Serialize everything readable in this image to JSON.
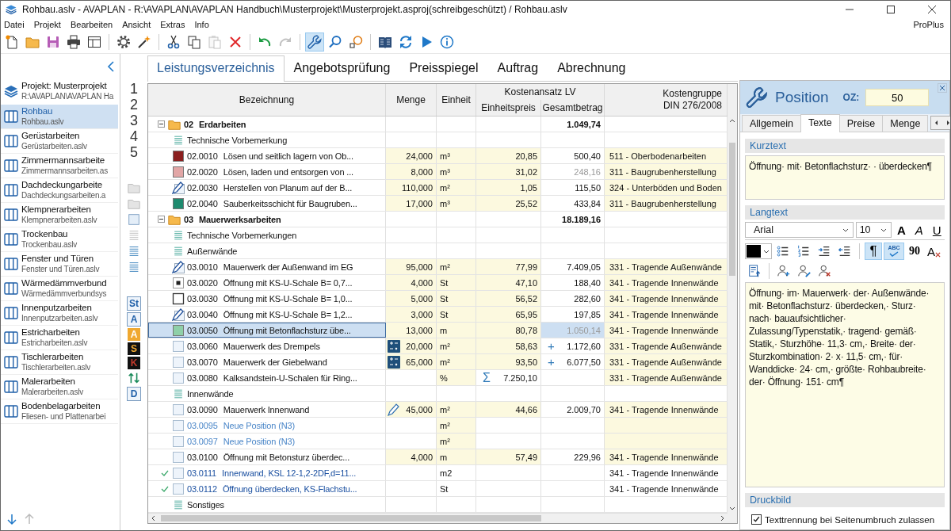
{
  "window": {
    "title": "Rohbau.aslv - AVAPLAN - R:\\AVAPLAN\\AVAPLAN Handbuch\\Musterprojekt\\Musterprojekt.asproj(schreibgeschützt) / Rohbau.aslv"
  },
  "menu": [
    "Datei",
    "Projekt",
    "Bearbeiten",
    "Ansicht",
    "Extras",
    "Info"
  ],
  "edition": "ProPlus",
  "toolbar": [
    {
      "kind": "new",
      "disabled": false,
      "pressed": false
    },
    {
      "kind": "open",
      "disabled": false,
      "pressed": false
    },
    {
      "kind": "save",
      "disabled": false,
      "pressed": false
    },
    {
      "kind": "print",
      "disabled": false,
      "pressed": false
    },
    {
      "kind": "layout",
      "disabled": false,
      "pressed": false
    },
    {
      "kind": "separator"
    },
    {
      "kind": "settings",
      "disabled": false,
      "pressed": false
    },
    {
      "kind": "wand",
      "disabled": false,
      "pressed": false
    },
    {
      "kind": "separator"
    },
    {
      "kind": "cut",
      "disabled": false,
      "pressed": false
    },
    {
      "kind": "copy",
      "disabled": false,
      "pressed": false
    },
    {
      "kind": "paste",
      "disabled": true,
      "pressed": false
    },
    {
      "kind": "delete",
      "disabled": false,
      "pressed": false
    },
    {
      "kind": "separator"
    },
    {
      "kind": "undo",
      "disabled": false,
      "pressed": false
    },
    {
      "kind": "redo",
      "disabled": true,
      "pressed": false
    },
    {
      "kind": "separator"
    },
    {
      "kind": "wrench",
      "disabled": false,
      "pressed": true
    },
    {
      "kind": "search",
      "disabled": false,
      "pressed": false
    },
    {
      "kind": "sum",
      "disabled": false,
      "pressed": false
    },
    {
      "kind": "separator"
    },
    {
      "kind": "book",
      "disabled": false,
      "pressed": false
    },
    {
      "kind": "refresh",
      "disabled": false,
      "pressed": false
    },
    {
      "kind": "play",
      "disabled": false,
      "pressed": false
    },
    {
      "kind": "info",
      "disabled": false,
      "pressed": false
    }
  ],
  "sidebar": {
    "project": {
      "name": "Projekt: Musterprojekt",
      "path": "R:\\AVAPLAN\\AVAPLAN Ha"
    },
    "items": [
      {
        "name": "Rohbau",
        "file": "Rohbau.aslv",
        "selected": true
      },
      {
        "name": "Gerüstarbeiten",
        "file": "Gerüstarbeiten.aslv",
        "selected": false
      },
      {
        "name": "Zimmermannsarbeite",
        "file": "Zimmermannsarbeiten.as",
        "selected": false
      },
      {
        "name": "Dachdeckungarbeite",
        "file": "Dachdeckungsarbeiten.a",
        "selected": false
      },
      {
        "name": "Klempnerarbeiten",
        "file": "Klempnerarbeiten.aslv",
        "selected": false
      },
      {
        "name": "Trockenbau",
        "file": "Trockenbau.aslv",
        "selected": false
      },
      {
        "name": "Fenster und Türen",
        "file": "Fenster und Türen.aslv",
        "selected": false
      },
      {
        "name": "Wärmedämmverbund",
        "file": "Wärmedämmverbundsys",
        "selected": false
      },
      {
        "name": "Innenputzarbeiten",
        "file": "Innenputzarbeiten.aslv",
        "selected": false
      },
      {
        "name": "Estricharbeiten",
        "file": "Estricharbeiten.aslv",
        "selected": false
      },
      {
        "name": "Tischlerarbeiten",
        "file": "Tischlerarbeiten.aslv",
        "selected": false
      },
      {
        "name": "Malerarbeiten",
        "file": "Malerarbeiten.aslv",
        "selected": false
      },
      {
        "name": "Bodenbelagarbeiten",
        "file": "Fliesen- und Plattenarbei",
        "selected": false
      }
    ]
  },
  "levels": [
    "1",
    "2",
    "3",
    "4",
    "5"
  ],
  "filters": [
    {
      "kind": "folder"
    },
    {
      "kind": "folder"
    },
    {
      "kind": "box"
    },
    {
      "kind": "lines-muted"
    },
    {
      "kind": "lines"
    },
    {
      "kind": "lines"
    },
    {
      "kind": "badge-light",
      "label": "St"
    },
    {
      "kind": "badge-light",
      "label": "A"
    },
    {
      "kind": "badge-orange",
      "label": "A"
    },
    {
      "kind": "badge-black-orange",
      "label": "S"
    },
    {
      "kind": "badge-black-red",
      "label": "K"
    },
    {
      "kind": "swap"
    },
    {
      "kind": "badge-light",
      "label": "D"
    }
  ],
  "tabs": [
    {
      "label": "Leistungsverzeichnis",
      "selected": true
    },
    {
      "label": "Angebotsprüfung",
      "selected": false
    },
    {
      "label": "Preisspiegel",
      "selected": false
    },
    {
      "label": "Auftrag",
      "selected": false
    },
    {
      "label": "Abrechnung",
      "selected": false
    }
  ],
  "table": {
    "columns": {
      "name": "Bezeichnung",
      "menge": "Menge",
      "einheit": "Einheit",
      "cost": "Kostenansatz LV",
      "ep": "Einheitspreis",
      "gb": "Gesamtbetrag",
      "kg": "Kostengruppe\nDIN 276/2008"
    },
    "rows": [
      {
        "kind": "group",
        "oz": "02",
        "text": "Erdarbeiten",
        "gb": "1.049,74",
        "expanded": true,
        "selected": false
      },
      {
        "kind": "note",
        "text": "Technische Vorbemerkung",
        "selected": false
      },
      {
        "kind": "item",
        "oz": "02.0010",
        "text": "Lösen und seitlich lagern von Ob...",
        "menge": "24,000",
        "einheit": "m³",
        "ep": "20,85",
        "gb": "500,40",
        "kg": "511 - Oberbodenarbeiten",
        "marker": {
          "kind": "swatch",
          "color": "#8b1f1f"
        },
        "selected": false,
        "shaded": true,
        "ticked": false
      },
      {
        "kind": "item",
        "oz": "02.0020",
        "text": "Lösen, laden und entsorgen von ...",
        "menge": "8,000",
        "einheit": "m³",
        "ep": "31,02",
        "gb": "248,16",
        "gb_muted": true,
        "kg": "311 - Baugrubenherstellung",
        "marker": {
          "kind": "swatch",
          "color": "#e2a6a6"
        },
        "selected": false,
        "shaded": true,
        "ticked": false
      },
      {
        "kind": "item",
        "oz": "02.0030",
        "text": "Herstellen von Planum auf der B...",
        "menge": "110,000",
        "einheit": "m²",
        "ep": "1,05",
        "gb": "115,50",
        "kg": "324 - Unterböden und Boden",
        "marker": {
          "kind": "pen"
        },
        "selected": false,
        "shaded": true,
        "ticked": false
      },
      {
        "kind": "item",
        "oz": "02.0040",
        "text": "Sauberkeitsschicht für Baugruben...",
        "menge": "17,000",
        "einheit": "m³",
        "ep": "25,52",
        "gb": "433,84",
        "kg": "311 - Baugrubenherstellung",
        "marker": {
          "kind": "swatch",
          "color": "#1e8a6e"
        },
        "selected": false,
        "shaded": true,
        "ticked": false
      },
      {
        "kind": "group",
        "oz": "03",
        "text": "Mauerwerksarbeiten",
        "gb": "18.189,16",
        "expanded": true,
        "selected": false
      },
      {
        "kind": "note",
        "text": "Technische Vorbemerkungen",
        "selected": false
      },
      {
        "kind": "note",
        "text": "Außenwände",
        "selected": false
      },
      {
        "kind": "item",
        "oz": "03.0010",
        "text": "Mauerwerk der Außenwand im EG",
        "menge": "95,000",
        "einheit": "m²",
        "ep": "77,99",
        "gb": "7.409,05",
        "kg": "331 - Tragende Außenwände",
        "marker": {
          "kind": "pen"
        },
        "selected": false,
        "shaded": true,
        "ticked": false
      },
      {
        "kind": "item",
        "oz": "03.0020",
        "text": "Öffnung mit KS-U-Schale B= 0,7...",
        "menge": "4,000",
        "einheit": "St",
        "ep": "47,10",
        "gb": "188,40",
        "kg": "341 - Tragende Innenwände",
        "marker": {
          "kind": "dot"
        },
        "selected": false,
        "shaded": true,
        "ticked": false
      },
      {
        "kind": "item",
        "oz": "03.0030",
        "text": "Öffnung mit KS-U-Schale B= 1,0...",
        "menge": "5,000",
        "einheit": "St",
        "ep": "56,52",
        "gb": "282,60",
        "kg": "341 - Tragende Innenwände",
        "marker": {
          "kind": "box"
        },
        "selected": false,
        "shaded": true,
        "ticked": false
      },
      {
        "kind": "item",
        "oz": "03.0040",
        "text": "Öffnung mit KS-U-Schale B= 1,2...",
        "menge": "3,000",
        "einheit": "St",
        "ep": "65,95",
        "gb": "197,85",
        "kg": "341 - Tragende Innenwände",
        "marker": {
          "kind": "pen"
        },
        "selected": false,
        "shaded": true,
        "ticked": false
      },
      {
        "kind": "item",
        "oz": "03.0050",
        "text": "Öffnung mit Betonflachsturz  übe...",
        "menge": "13,000",
        "einheit": "m",
        "ep": "80,78",
        "gb": "1.050,14",
        "gb_muted": true,
        "kg": "341 - Tragende Innenwände",
        "marker": {
          "kind": "swatch",
          "color": "#8fd0a8"
        },
        "selected": true,
        "shaded": true,
        "ticked": false
      },
      {
        "kind": "item",
        "oz": "03.0060",
        "text": "Mauerwerk des Drempels",
        "menge_tool": {
          "kind": "calc"
        },
        "menge": "20,000",
        "einheit": "m²",
        "ep": "58,63",
        "gb_prefix": "+",
        "gb": "1.172,60",
        "kg": "331 - Tragende Außenwände",
        "marker": {
          "kind": "blank"
        },
        "selected": false,
        "shaded": true,
        "ticked": false
      },
      {
        "kind": "item",
        "oz": "03.0070",
        "text": "Mauerwerk der Giebelwand",
        "menge_tool": {
          "kind": "calc"
        },
        "menge": "65,000",
        "einheit": "m²",
        "ep": "93,50",
        "gb_prefix": "+",
        "gb": "6.077,50",
        "kg": "331 - Tragende Außenwände",
        "marker": {
          "kind": "blank"
        },
        "selected": false,
        "shaded": true,
        "ticked": false
      },
      {
        "kind": "item",
        "oz": "03.0080",
        "text": "Kalksandstein-U-Schalen für Ring...",
        "einheit": "%",
        "ep_prefix": "Σ",
        "ep": "7.250,10",
        "kg": "331 - Tragende Außenwände",
        "marker": {
          "kind": "blank"
        },
        "selected": false,
        "shaded": true,
        "ticked": false
      },
      {
        "kind": "note",
        "text": "Innenwände",
        "selected": false
      },
      {
        "kind": "item",
        "oz": "03.0090",
        "text": "Mauerwerk Innenwand",
        "menge_tool": {
          "kind": "pen"
        },
        "menge": "45,000",
        "einheit": "m²",
        "ep": "44,66",
        "gb": "2.009,70",
        "kg": "341 - Tragende Innenwände",
        "marker": {
          "kind": "blank"
        },
        "selected": false,
        "shaded": true,
        "ticked": false
      },
      {
        "kind": "new-item",
        "oz": "03.0095",
        "text": "Neue Position (N3)",
        "einheit": "m²",
        "marker": {
          "kind": "blank"
        },
        "selected": false,
        "shaded": true,
        "ticked": false
      },
      {
        "kind": "new-item",
        "oz": "03.0097",
        "text": "Neue Position (N3)",
        "einheit": "m²",
        "marker": {
          "kind": "blank"
        },
        "selected": false,
        "shaded": true,
        "ticked": false
      },
      {
        "kind": "item",
        "oz": "03.0100",
        "text": "Öffnung mit Betonsturz  überdec...",
        "menge": "4,000",
        "einheit": "m",
        "ep": "57,49",
        "gb": "229,96",
        "kg": "341 - Tragende Innenwände",
        "marker": {
          "kind": "blank"
        },
        "selected": false,
        "shaded": true,
        "ticked": false
      },
      {
        "kind": "linked-item",
        "oz": "03.0111",
        "text": "Innenwand, KSL 12-1,2-2DF,d=11...",
        "einheit": "m2",
        "kg": "341 - Tragende Innenwände",
        "marker": {
          "kind": "blank"
        },
        "selected": false,
        "shaded": false,
        "ticked": true
      },
      {
        "kind": "linked-item",
        "oz": "03.0112",
        "text": "Öffnung überdecken, KS-Flachstu...",
        "einheit": "St",
        "kg": "341 - Tragende Innenwände",
        "marker": {
          "kind": "blank"
        },
        "selected": false,
        "shaded": false,
        "ticked": true
      },
      {
        "kind": "note",
        "text": "Sonstiges",
        "selected": false
      }
    ]
  },
  "panel": {
    "title": "Position",
    "oz_label": "OZ:",
    "oz": "50",
    "tabs": [
      {
        "label": "Allgemein",
        "selected": false
      },
      {
        "label": "Texte",
        "selected": true
      },
      {
        "label": "Preise",
        "selected": false
      },
      {
        "label": "Menge",
        "selected": false
      }
    ],
    "short_title": "Kurztext",
    "short_text": "Öffnung· mit· Betonflachsturz· · überdecken¶",
    "long_title": "Langtext",
    "font": "Arial",
    "size": "10",
    "format": [
      {
        "kind": "bold",
        "label": "A"
      },
      {
        "kind": "italic",
        "label": "A"
      },
      {
        "kind": "underline",
        "label": "U"
      }
    ],
    "tools": [
      {
        "kind": "color",
        "color": "#000000"
      },
      {
        "kind": "bullets"
      },
      {
        "kind": "numbers"
      },
      {
        "kind": "indent"
      },
      {
        "kind": "outdent"
      },
      {
        "kind": "separator"
      },
      {
        "kind": "pilcrow",
        "label": "¶",
        "pressed": true
      },
      {
        "kind": "spell",
        "label": "ABC",
        "pressed": true
      },
      {
        "kind": "rotate",
        "label": "90",
        "pressed": false
      },
      {
        "kind": "clear",
        "label": "A",
        "pressed": false
      }
    ],
    "tools2": [
      {
        "kind": "import"
      },
      {
        "kind": "separator"
      },
      {
        "kind": "person-add"
      },
      {
        "kind": "person-edit"
      },
      {
        "kind": "person-remove"
      }
    ],
    "long_text": "Öffnung· im· Mauerwerk· der· Außenwände· mit· Betonflachsturz· überdecken,· Sturz· nach· bauaufsichtlicher· Zulassung/Typenstatik,· tragend· gemäß· Statik,· Sturzhöhe· 11,3· cm,· Breite· der· Sturzkombination· 2· x· 11,5· cm,· für· Wanddicke· 24· cm,· größte· Rohbaubreite· der· Öffnung· 151· cm¶",
    "print_title": "Druckbild",
    "hyphenation": {
      "label": "Texttrennung bei Seitenumbruch zulassen",
      "checked": true
    }
  }
}
